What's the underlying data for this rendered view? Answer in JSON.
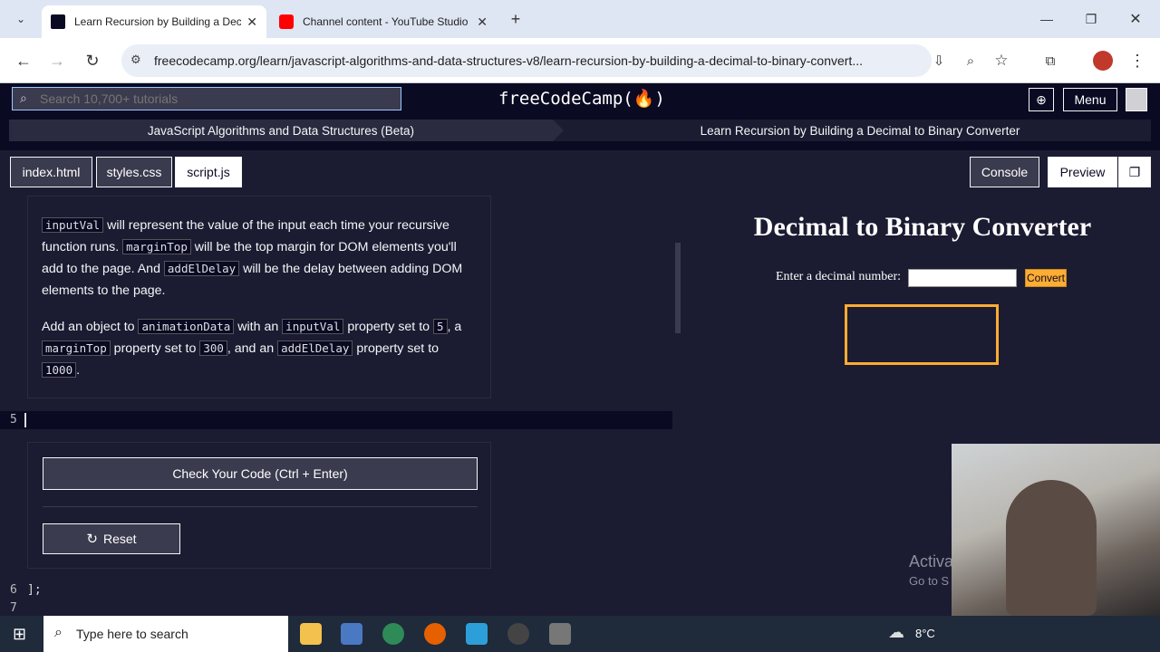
{
  "browser": {
    "tabs": [
      {
        "title": "Learn Recursion by Building a Decimal",
        "active": true
      },
      {
        "title": "Channel content - YouTube Studio",
        "active": false
      }
    ],
    "url": "freecodecamp.org/learn/javascript-algorithms-and-data-structures-v8/learn-recursion-by-building-a-decimal-to-binary-convert..."
  },
  "fcc": {
    "search_placeholder": "Search 10,700+ tutorials",
    "brand": "freeCodeCamp(🔥)",
    "menu_label": "Menu",
    "breadcrumb_course": "JavaScript Algorithms and Data Structures (Beta)",
    "breadcrumb_lesson": "Learn Recursion by Building a Decimal to Binary Converter"
  },
  "files": [
    "index.html",
    "styles.css",
    "script.js"
  ],
  "right_buttons": {
    "console": "Console",
    "preview": "Preview"
  },
  "description": {
    "p1": {
      "c1": "inputVal",
      "t1": " will represent the value of the input each time your recursive function runs. ",
      "c2": "marginTop",
      "t2": " will be the top margin for DOM elements you'll add to the page. And ",
      "c3": "addElDelay",
      "t3": " will be the delay between adding DOM elements to the page."
    },
    "p2": {
      "t1": "Add an object to ",
      "c1": "animationData",
      "t2": " with an ",
      "c2": "inputVal",
      "t3": " property set to ",
      "c3": "5",
      "t4": ", a ",
      "c4": "marginTop",
      "t5": " property set to ",
      "c5": "300",
      "t6": ", and an ",
      "c6": "addElDelay",
      "t7": " property set to ",
      "c7": "1000",
      "t8": "."
    }
  },
  "editor": {
    "line5": "5",
    "line6": "6",
    "line6_code": "];",
    "line7": "7"
  },
  "actions": {
    "check": "Check Your Code (Ctrl + Enter)",
    "reset": "Reset"
  },
  "preview": {
    "title": "Decimal to Binary Converter",
    "label": "Enter a decimal number:",
    "convert": "Convert"
  },
  "watermark": {
    "line1": "Activa",
    "line2": "Go to S"
  },
  "taskbar": {
    "search": "Type here to search",
    "temp": "8°C"
  }
}
